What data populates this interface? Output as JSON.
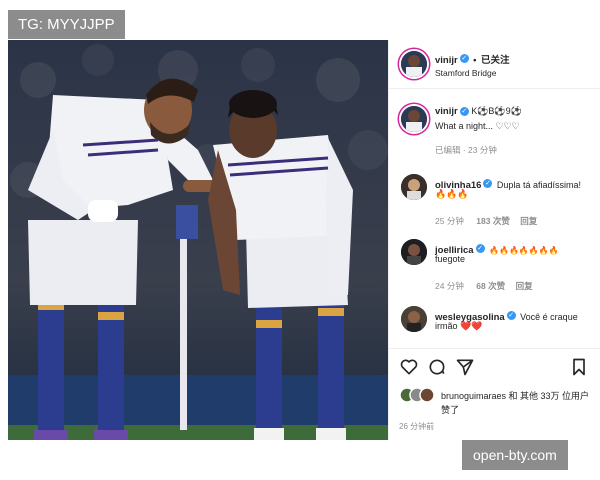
{
  "watermark_top": "TG: MYYJJPP",
  "watermark_bottom": "open-bty.com",
  "post": {
    "username": "vinijr",
    "dot": "•",
    "follow_status": "已关注",
    "location": "Stamford Bridge"
  },
  "caption": {
    "username": "vinijr",
    "emoji_line": "K⚽B⚽9⚽",
    "text": "What a night... ♡♡♡",
    "meta": "已编辑 · 23 分钟"
  },
  "comments": [
    {
      "username": "olivinha16",
      "text": "Dupla tá afiadíssima!",
      "emojis": "🔥🔥🔥",
      "time": "25 分钟",
      "likes": "183 次赞",
      "reply": "回复"
    },
    {
      "username": "joellirica",
      "text": "🔥🔥🔥🔥🔥🔥🔥",
      "text2": "fuegote",
      "time": "24 分钟",
      "likes": "68 次赞",
      "reply": "回复"
    },
    {
      "username": "wesleygasolina",
      "text": "Você é craque",
      "text2": "irmão ❤️❤️"
    }
  ],
  "likes_line": "brunoguimaraes 和 其他 33万 位用户",
  "likes_line2": "赞了",
  "post_time": "26 分钟前",
  "icons": [
    "heart-icon",
    "comment-icon",
    "share-icon",
    "bookmark-icon",
    "verified-icon"
  ]
}
